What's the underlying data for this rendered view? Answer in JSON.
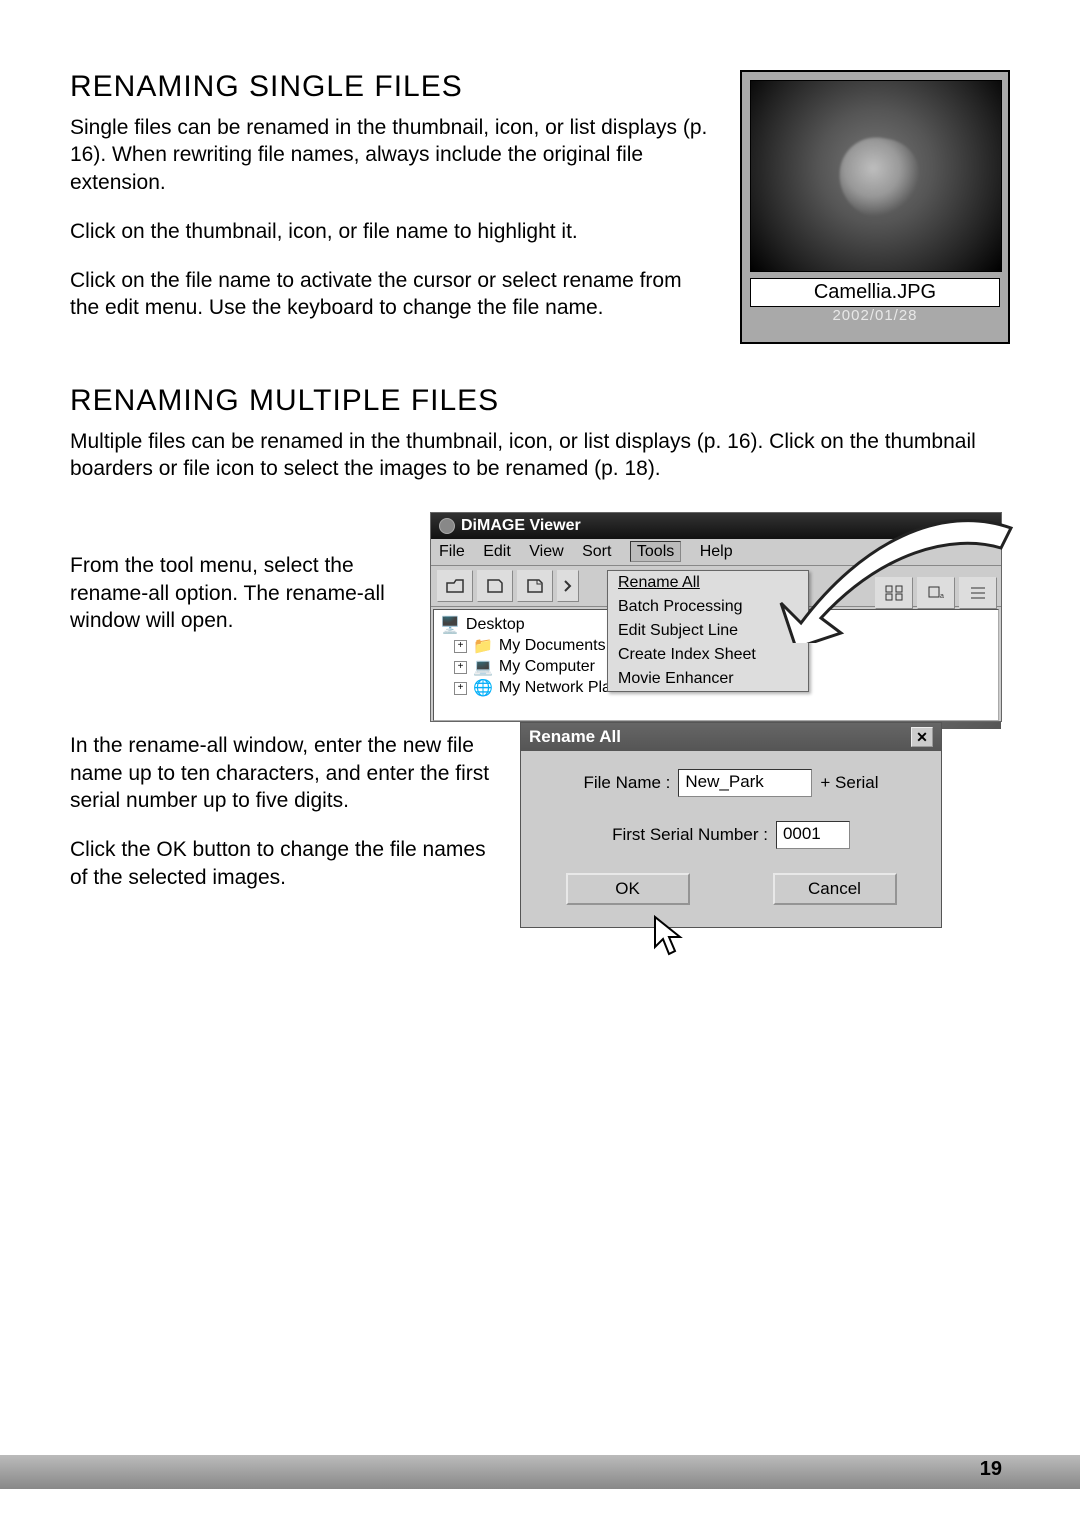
{
  "section1": {
    "heading": "RENAMING SINGLE FILES",
    "p1": "Single files can be renamed in the thumbnail, icon, or list displays (p. 16). When rewriting file names, always include the original file extension.",
    "p2": "Click on the thumbnail, icon, or file name to highlight it.",
    "p3": "Click on the file name to activate the cursor or select rename from the edit menu. Use the keyboard to change the file name."
  },
  "thumb": {
    "filename": "Camellia.JPG",
    "date": "2002/01/28"
  },
  "section2": {
    "heading": "RENAMING MULTIPLE FILES",
    "p1": "Multiple files can be renamed in the thumbnail, icon, or list displays (p. 16). Click on the thumbnail boarders or file icon to select the images to be renamed (p. 18).",
    "step1": "From the tool menu, select the rename-all option. The rename-all window will open.",
    "step2a": "In the rename-all window, enter the new file name up to ten characters, and enter the first serial number up to five digits.",
    "step2b": "Click the OK button to change the file names of the selected images."
  },
  "app": {
    "title": "DiMAGE Viewer",
    "menus": {
      "file": "File",
      "edit": "Edit",
      "view": "View",
      "sort": "Sort",
      "tools": "Tools",
      "help": "Help"
    },
    "toolsMenu": {
      "renameAll": "Rename All",
      "batch": "Batch Processing",
      "subject": "Edit Subject Line",
      "index": "Create Index Sheet",
      "movie": "Movie Enhancer"
    },
    "tree": {
      "desktop": "Desktop",
      "mydocs": "My Documents",
      "mycomp": "My Computer",
      "netplaces": "My Network Places"
    }
  },
  "dialog": {
    "title": "Rename All",
    "fileNameLabel": "File Name :",
    "fileNameValue": "New_Park",
    "serialSuffix": "+ Serial",
    "serialLabel": "First Serial Number :",
    "serialValue": "0001",
    "ok": "OK",
    "cancel": "Cancel"
  },
  "pageNumber": "19"
}
